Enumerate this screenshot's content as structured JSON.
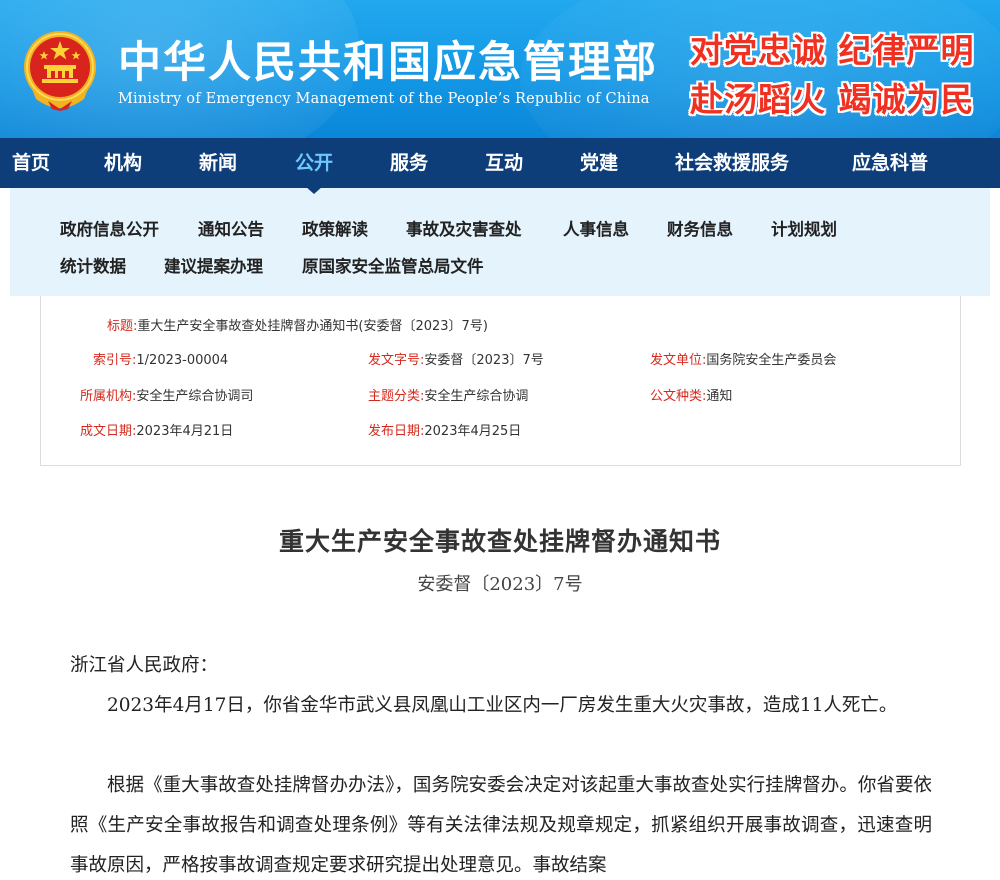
{
  "header": {
    "title": "中华人民共和国应急管理部",
    "subtitle": "Ministry of Emergency Management of the People’s Republic of China",
    "slogan_line1": "对党忠诚  纪律严明",
    "slogan_line2": "赴汤蹈火  竭诚为民"
  },
  "main_nav": [
    "首页",
    "机构",
    "新闻",
    "公开",
    "服务",
    "互动",
    "党建",
    "社会救援服务",
    "应急科普"
  ],
  "active_nav": "公开",
  "sub_nav": [
    "政府信息公开",
    "通知公告",
    "政策解读",
    "事故及灾害查处",
    "人事信息",
    "财务信息",
    "计划规划",
    "统计数据",
    "建议提案办理",
    "原国家安全监管总局文件"
  ],
  "meta": {
    "title_label": "标题:",
    "title_value": "重大生产安全事故查处挂牌督办通知书(安委督〔2023〕7号)",
    "index_label": "索引号:",
    "index_value": "1/2023-00004",
    "docno_label": "发文字号:",
    "docno_value": "安委督〔2023〕7号",
    "issuer_label": "发文单位:",
    "issuer_value": "国务院安全生产委员会",
    "agency_label": "所属机构:",
    "agency_value": "安全生产综合协调司",
    "topic_label": "主题分类:",
    "topic_value": "安全生产综合协调",
    "type_label": "公文种类:",
    "type_value": "通知",
    "created_label": "成文日期:",
    "created_value": "2023年4月21日",
    "published_label": "发布日期:",
    "published_value": "2023年4月25日"
  },
  "article": {
    "title": "重大生产安全事故查处挂牌督办通知书",
    "doc_no": "安委督〔2023〕7号",
    "salutation": "浙江省人民政府：",
    "para1": "2023年4月17日，你省金华市武义县凤凰山工业区内一厂房发生重大火灾事故，造成11人死亡。",
    "para2": "根据《重大事故查处挂牌督办办法》，国务院安委会决定对该起重大事故查处实行挂牌督办。你省要依照《生产安全事故报告和调查处理条例》等有关法律法规及规章规定，抓紧组织开展事故调查，迅速查明事故原因，严格按事故调查规定要求研究提出处理意见。事故结案"
  },
  "colors": {
    "header_blue": "#1296e4",
    "nav_dark_blue": "#0e3e7a",
    "nav_active": "#6cc8ff",
    "subnav_bg": "#e4f3fc",
    "meta_label_red": "#d42a1e",
    "slogan_red": "#f03020"
  }
}
